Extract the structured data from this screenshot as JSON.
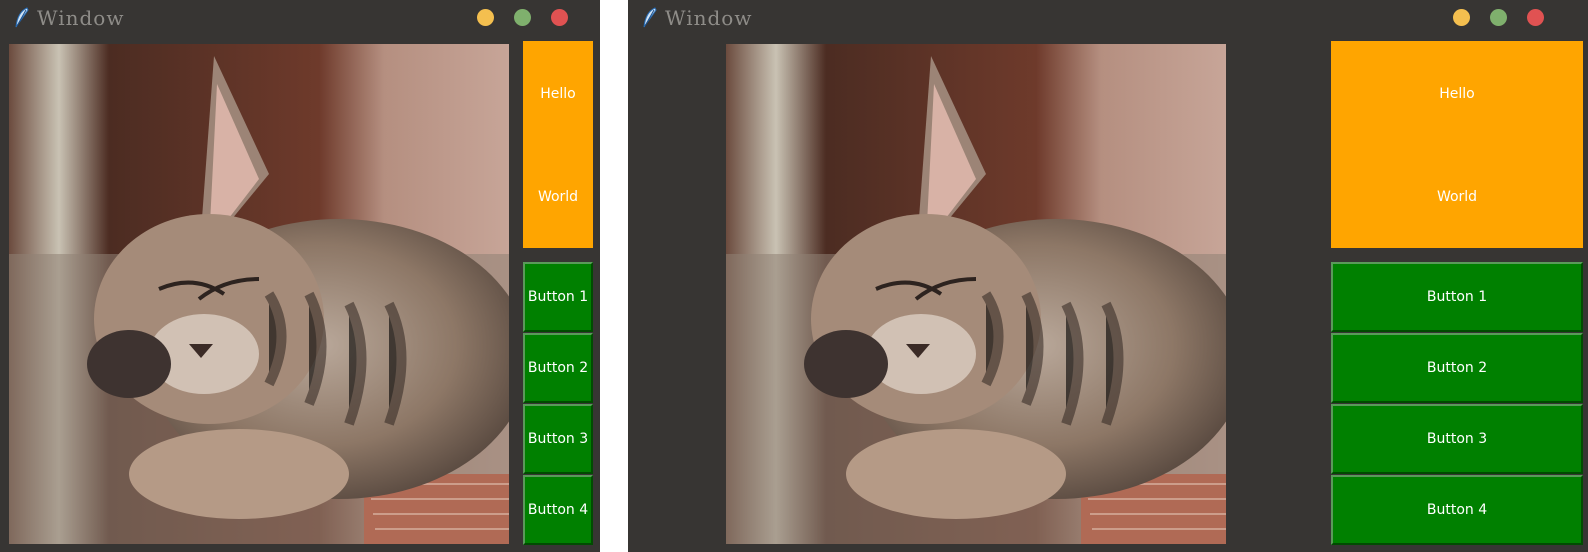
{
  "windows": [
    {
      "title": "Window",
      "panel": {
        "hello": "Hello",
        "world": "World"
      },
      "buttons": [
        "Button 1",
        "Button 2",
        "Button 3",
        "Button 4"
      ]
    },
    {
      "title": "Window",
      "panel": {
        "hello": "Hello",
        "world": "World"
      },
      "buttons": [
        "Button 1",
        "Button 2",
        "Button 3",
        "Button 4"
      ]
    }
  ],
  "icons": {
    "app": "feather-icon",
    "minimize": "yellow-dot",
    "maximize": "green-dot",
    "close": "red-dot"
  },
  "colors": {
    "window_background": "#373533",
    "panel": "#ffa500",
    "button": "#008000",
    "title_text": "#8e8c88",
    "minimize_dot": "#f4bf4f",
    "maximize_dot": "#7fb06d",
    "close_dot": "#e05252"
  }
}
